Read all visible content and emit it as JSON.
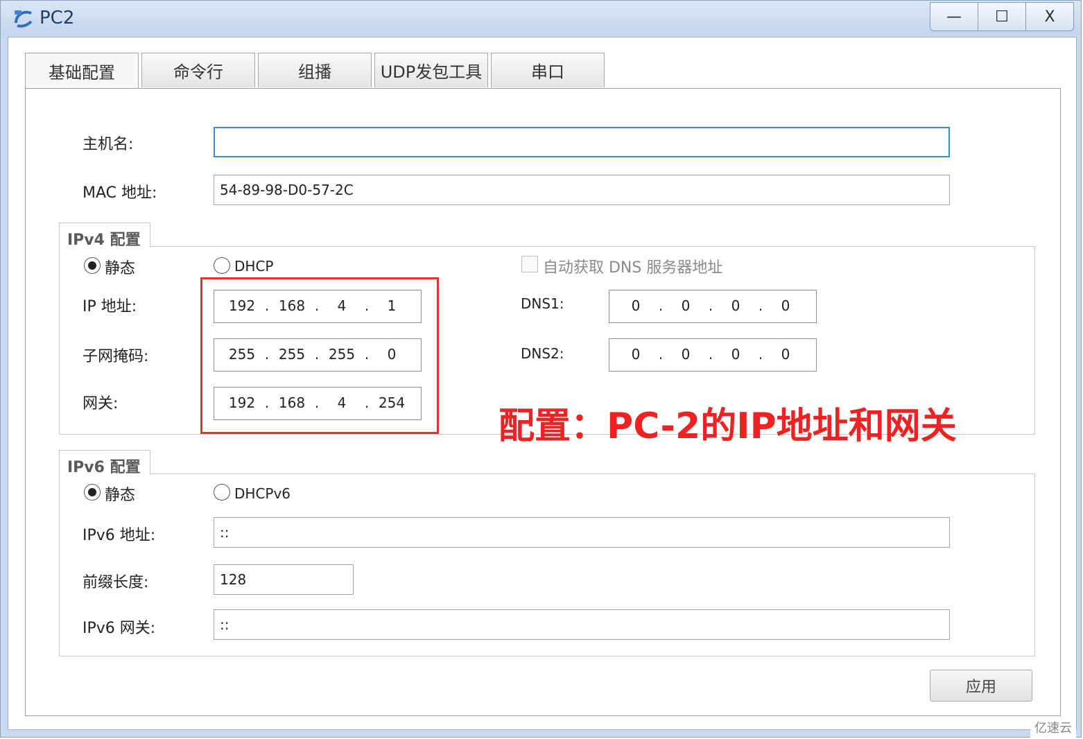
{
  "window": {
    "title": "PC2",
    "minimize_label": "—",
    "maximize_label": "☐",
    "close_label": "X"
  },
  "tabs": [
    {
      "label": "基础配置",
      "active": true
    },
    {
      "label": "命令行"
    },
    {
      "label": "组播"
    },
    {
      "label": "UDP发包工具"
    },
    {
      "label": "串口"
    }
  ],
  "basic": {
    "hostname_label": "主机名:",
    "hostname_value": "",
    "mac_label": "MAC 地址:",
    "mac_value": "54-89-98-D0-57-2C"
  },
  "ipv4": {
    "group_title": "IPv4 配置",
    "static_label": "静态",
    "dhcp_label": "DHCP",
    "auto_dns_label": "自动获取 DNS 服务器地址",
    "ip_label": "IP 地址:",
    "ip": [
      "192",
      "168",
      "4",
      "1"
    ],
    "mask_label": "子网掩码:",
    "mask": [
      "255",
      "255",
      "255",
      "0"
    ],
    "gateway_label": "网关:",
    "gateway": [
      "192",
      "168",
      "4",
      "254"
    ],
    "dns1_label": "DNS1:",
    "dns1": [
      "0",
      "0",
      "0",
      "0"
    ],
    "dns2_label": "DNS2:",
    "dns2": [
      "0",
      "0",
      "0",
      "0"
    ]
  },
  "ipv6": {
    "group_title": "IPv6 配置",
    "static_label": "静态",
    "dhcpv6_label": "DHCPv6",
    "address_label": "IPv6 地址:",
    "address_value": "::",
    "prefix_label": "前缀长度:",
    "prefix_value": "128",
    "gateway_label": "IPv6 网关:",
    "gateway_value": "::"
  },
  "apply_label": "应用",
  "annotation": "配置：PC-2的IP地址和网关",
  "watermark": "亿速云",
  "colors": {
    "annotation": "#ee2222",
    "focus_border": "#3a8ad6",
    "title_bar": "#c9daf0"
  }
}
